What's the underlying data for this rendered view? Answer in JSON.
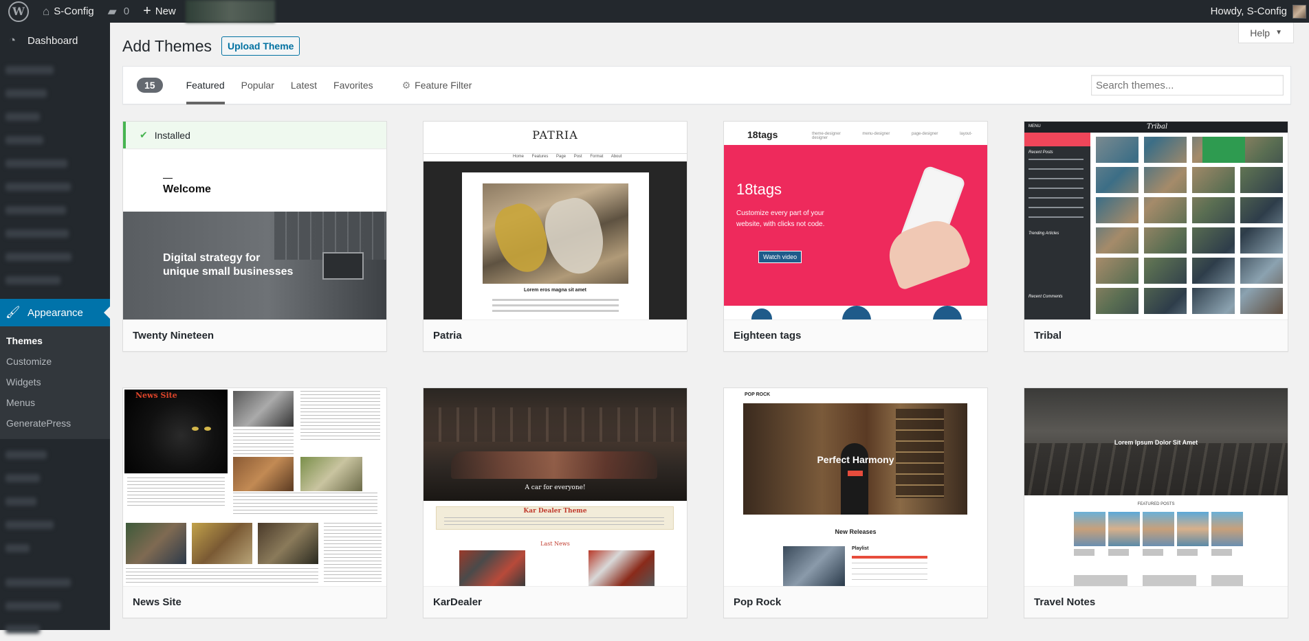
{
  "adminbar": {
    "site_name": "S-Config",
    "comments_count": "0",
    "new_label": "New",
    "howdy": "Howdy, S-Config"
  },
  "sidebar": {
    "dashboard": "Dashboard",
    "appearance": "Appearance",
    "submenu": [
      {
        "label": "Themes"
      },
      {
        "label": "Customize"
      },
      {
        "label": "Widgets"
      },
      {
        "label": "Menus"
      },
      {
        "label": "GeneratePress"
      }
    ]
  },
  "header": {
    "title": "Add Themes",
    "upload_button": "Upload Theme",
    "help": "Help"
  },
  "filters": {
    "count": "15",
    "tabs": [
      "Featured",
      "Popular",
      "Latest",
      "Favorites"
    ],
    "feature_filter": "Feature Filter",
    "search_placeholder": "Search themes..."
  },
  "themes": [
    {
      "name": "Twenty Nineteen",
      "installed_label": "Installed",
      "shot": {
        "welcome": "Welcome",
        "tagline1": "Digital strategy for",
        "tagline2": "unique small businesses"
      }
    },
    {
      "name": "Patria",
      "shot": {
        "logo": "PATRIA",
        "nav": [
          "Home",
          "Features",
          "Page",
          "Post Format",
          "About"
        ],
        "post_title": "Lorem eros magna sit amet"
      }
    },
    {
      "name": "Eighteen tags",
      "shot": {
        "logo": "18tags",
        "nav": [
          "theme designer",
          "menu designer",
          "page designer",
          "layout designer"
        ],
        "headline": "18tags",
        "sub1": "Customize every part of your",
        "sub2": "website, with clicks not code.",
        "cta": "Watch video"
      }
    },
    {
      "name": "Tribal",
      "shot": {
        "menu": "MENU",
        "logo": "Tribal",
        "recent_posts": "Recent Posts",
        "trending": "Trending Articles",
        "recent_comments": "Recent Comments"
      }
    },
    {
      "name": "News Site",
      "shot": {
        "logo": "News Site"
      }
    },
    {
      "name": "KarDealer",
      "shot": {
        "hero": "A car for everyone!",
        "box_title": "Kar Dealer Theme",
        "latest": "Last News"
      }
    },
    {
      "name": "Pop Rock",
      "shot": {
        "logo": "POP ROCK",
        "hero": "Perfect Harmony",
        "section": "New Releases",
        "playlist": "Playlist"
      }
    },
    {
      "name": "Travel Notes",
      "shot": {
        "hero": "Lorem Ipsum Dolor Sit Amet",
        "featured": "FEATURED POSTS"
      }
    }
  ],
  "colors": {
    "adminbar": "#23282d",
    "accent": "#0073aa",
    "installed": "#46b450",
    "eighteen_tags_pink": "#ee2a5c"
  }
}
